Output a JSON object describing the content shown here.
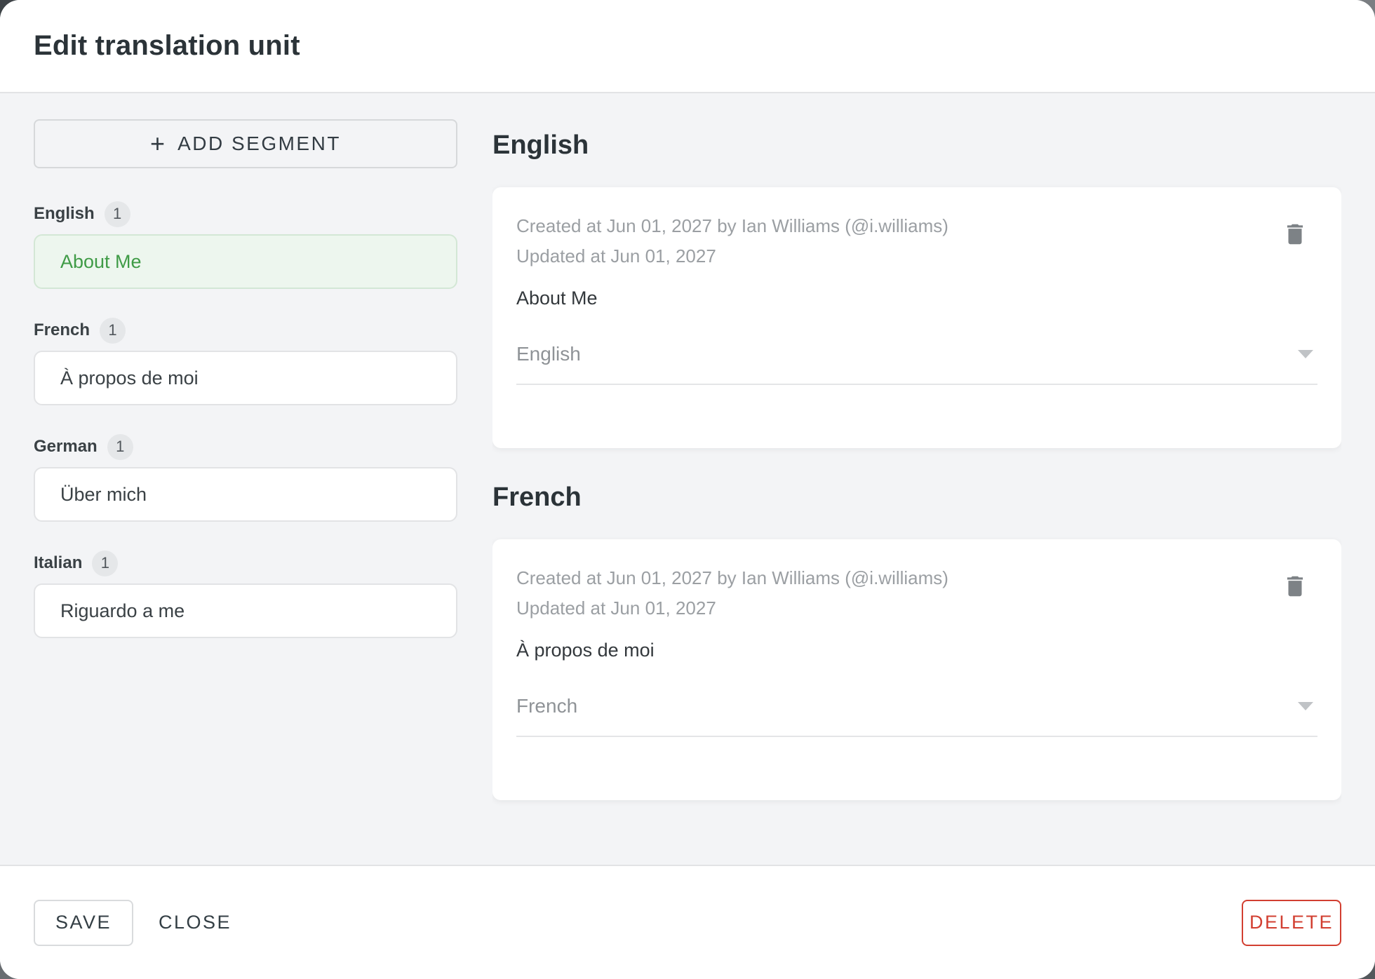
{
  "dialog": {
    "title": "Edit translation unit"
  },
  "sidebar": {
    "add_segment_label": "ADD SEGMENT",
    "plus_icon": "+",
    "groups": [
      {
        "language": "English",
        "count": "1",
        "text": "About Me",
        "selected": true
      },
      {
        "language": "French",
        "count": "1",
        "text": "À propos de moi",
        "selected": false
      },
      {
        "language": "German",
        "count": "1",
        "text": "Über mich",
        "selected": false
      },
      {
        "language": "Italian",
        "count": "1",
        "text": "Riguardo a me",
        "selected": false
      }
    ]
  },
  "main": {
    "sections": [
      {
        "heading": "English",
        "created_line": "Created at Jun 01, 2027 by Ian Williams (@i.williams)",
        "updated_line": "Updated at Jun 01, 2027",
        "text": "About Me",
        "language_select": "English"
      },
      {
        "heading": "French",
        "created_line": "Created at Jun 01, 2027 by Ian Williams (@i.williams)",
        "updated_line": "Updated at Jun 01, 2027",
        "text": "À propos de moi",
        "language_select": "French"
      }
    ]
  },
  "footer": {
    "save_label": "SAVE",
    "close_label": "CLOSE",
    "delete_label": "DELETE"
  },
  "colors": {
    "accent_green": "#3f9b46",
    "selected_bg": "#edf6ee",
    "selected_border": "#d3e7d5",
    "danger_red": "#d23f31",
    "body_bg": "#f3f4f6"
  }
}
